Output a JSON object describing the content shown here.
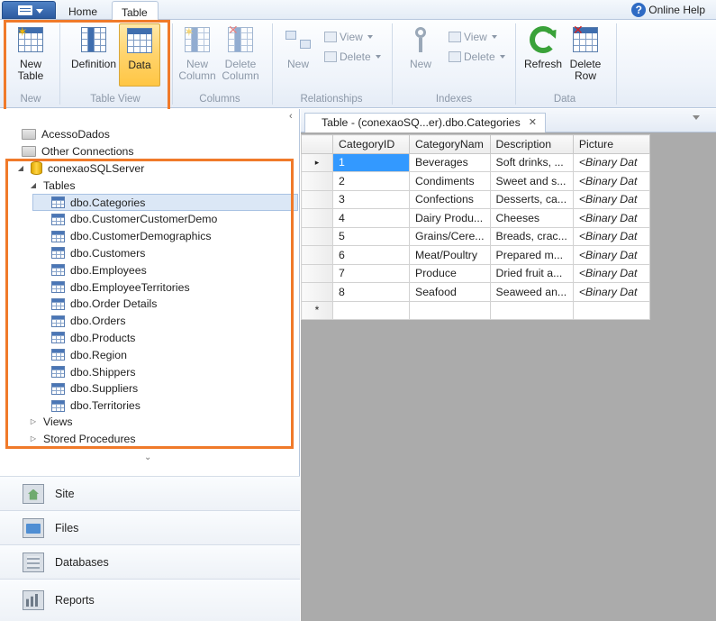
{
  "tabs": {
    "file_menu": "",
    "home": "Home",
    "table": "Table"
  },
  "help": {
    "label": "Online Help"
  },
  "ribbon": {
    "new_group": {
      "label": "New",
      "new_table": "New\nTable"
    },
    "table_view": {
      "label": "Table View",
      "definition": "Definition",
      "data": "Data"
    },
    "columns": {
      "label": "Columns",
      "new_column": "New\nColumn",
      "delete_column": "Delete\nColumn"
    },
    "relationships": {
      "label": "Relationships",
      "new": "New",
      "view": "View",
      "delete": "Delete"
    },
    "indexes": {
      "label": "Indexes",
      "new": "New",
      "view": "View",
      "delete": "Delete"
    },
    "data": {
      "label": "Data",
      "refresh": "Refresh",
      "delete_row": "Delete\nRow"
    }
  },
  "tree": {
    "acesso": "AcessoDados",
    "other": "Other Connections",
    "server": "conexaoSQLServer",
    "tables_folder": "Tables",
    "tables": [
      "dbo.Categories",
      "dbo.CustomerCustomerDemo",
      "dbo.CustomerDemographics",
      "dbo.Customers",
      "dbo.Employees",
      "dbo.EmployeeTerritories",
      "dbo.Order Details",
      "dbo.Orders",
      "dbo.Products",
      "dbo.Region",
      "dbo.Shippers",
      "dbo.Suppliers",
      "dbo.Territories"
    ],
    "views": "Views",
    "stored_procedures": "Stored Procedures"
  },
  "nav": {
    "site": "Site",
    "files": "Files",
    "databases": "Databases",
    "reports": "Reports"
  },
  "document": {
    "tab_title": "Table - (conexaoSQ...er).dbo.Categories",
    "columns": [
      "CategoryID",
      "CategoryNam",
      "Description",
      "Picture"
    ],
    "rows": [
      [
        "1",
        "Beverages",
        "Soft drinks, ...",
        "<Binary Dat"
      ],
      [
        "2",
        "Condiments",
        "Sweet and s...",
        "<Binary Dat"
      ],
      [
        "3",
        "Confections",
        "Desserts, ca...",
        "<Binary Dat"
      ],
      [
        "4",
        "Dairy Produ...",
        "Cheeses",
        "<Binary Dat"
      ],
      [
        "5",
        "Grains/Cere...",
        "Breads, crac...",
        "<Binary Dat"
      ],
      [
        "6",
        "Meat/Poultry",
        "Prepared m...",
        "<Binary Dat"
      ],
      [
        "7",
        "Produce",
        "Dried fruit a...",
        "<Binary Dat"
      ],
      [
        "8",
        "Seafood",
        "Seaweed an...",
        "<Binary Dat"
      ]
    ],
    "new_row_marker": "*",
    "current_row_marker": "▸"
  },
  "colors": {
    "highlight": "#f07a2a",
    "selection": "#3399ff",
    "accent": "#2c5aa0"
  }
}
